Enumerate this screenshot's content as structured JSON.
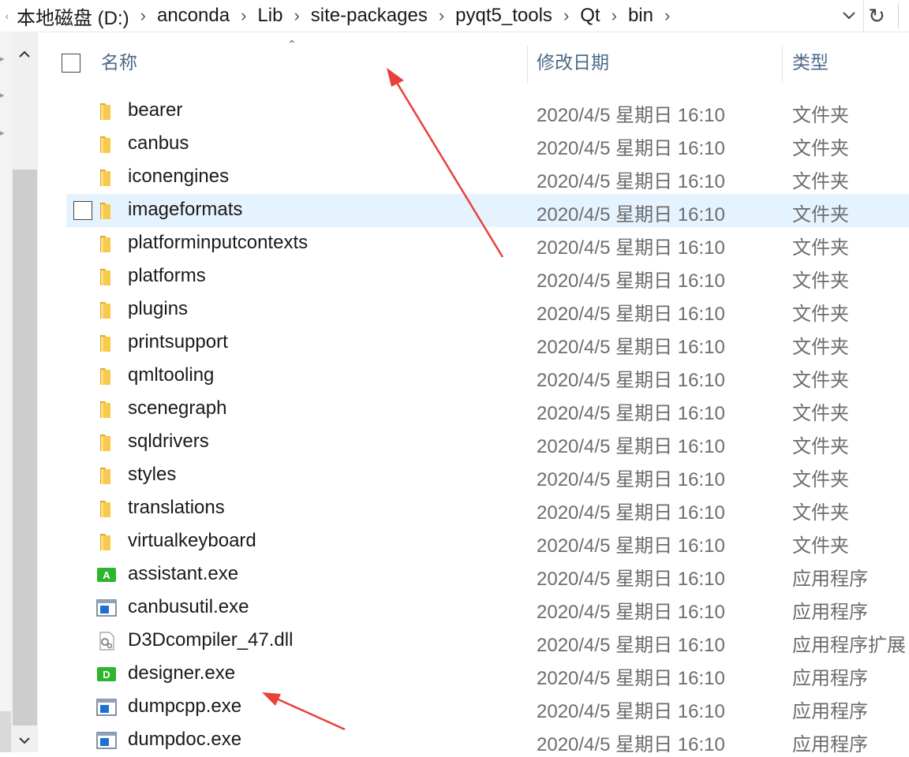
{
  "address_bar": {
    "crumbs": [
      "本地磁盘 (D:)",
      "anconda",
      "Lib",
      "site-packages",
      "pyqt5_tools",
      "Qt",
      "bin"
    ]
  },
  "header": {
    "name": "名称",
    "date": "修改日期",
    "type": "类型"
  },
  "rows": [
    {
      "name": "bearer",
      "date": "2020/4/5 星期日 16:10",
      "type": "文件夹",
      "icon": "folder"
    },
    {
      "name": "canbus",
      "date": "2020/4/5 星期日 16:10",
      "type": "文件夹",
      "icon": "folder"
    },
    {
      "name": "iconengines",
      "date": "2020/4/5 星期日 16:10",
      "type": "文件夹",
      "icon": "folder"
    },
    {
      "name": "imageformats",
      "date": "2020/4/5 星期日 16:10",
      "type": "文件夹",
      "icon": "folder"
    },
    {
      "name": "platforminputcontexts",
      "date": "2020/4/5 星期日 16:10",
      "type": "文件夹",
      "icon": "folder"
    },
    {
      "name": "platforms",
      "date": "2020/4/5 星期日 16:10",
      "type": "文件夹",
      "icon": "folder"
    },
    {
      "name": "plugins",
      "date": "2020/4/5 星期日 16:10",
      "type": "文件夹",
      "icon": "folder"
    },
    {
      "name": "printsupport",
      "date": "2020/4/5 星期日 16:10",
      "type": "文件夹",
      "icon": "folder"
    },
    {
      "name": "qmltooling",
      "date": "2020/4/5 星期日 16:10",
      "type": "文件夹",
      "icon": "folder"
    },
    {
      "name": "scenegraph",
      "date": "2020/4/5 星期日 16:10",
      "type": "文件夹",
      "icon": "folder"
    },
    {
      "name": "sqldrivers",
      "date": "2020/4/5 星期日 16:10",
      "type": "文件夹",
      "icon": "folder"
    },
    {
      "name": "styles",
      "date": "2020/4/5 星期日 16:10",
      "type": "文件夹",
      "icon": "folder"
    },
    {
      "name": "translations",
      "date": "2020/4/5 星期日 16:10",
      "type": "文件夹",
      "icon": "folder"
    },
    {
      "name": "virtualkeyboard",
      "date": "2020/4/5 星期日 16:10",
      "type": "文件夹",
      "icon": "folder"
    },
    {
      "name": "assistant.exe",
      "date": "2020/4/5 星期日 16:10",
      "type": "应用程序",
      "icon": "app-green",
      "letter": "A"
    },
    {
      "name": "canbusutil.exe",
      "date": "2020/4/5 星期日 16:10",
      "type": "应用程序",
      "icon": "app-window"
    },
    {
      "name": "D3Dcompiler_47.dll",
      "date": "2020/4/5 星期日 16:10",
      "type": "应用程序扩展",
      "icon": "dll-gear"
    },
    {
      "name": "designer.exe",
      "date": "2020/4/5 星期日 16:10",
      "type": "应用程序",
      "icon": "app-green",
      "letter": "D"
    },
    {
      "name": "dumpcpp.exe",
      "date": "2020/4/5 星期日 16:10",
      "type": "应用程序",
      "icon": "app-window"
    },
    {
      "name": "dumpdoc.exe",
      "date": "2020/4/5 星期日 16:10",
      "type": "应用程序",
      "icon": "app-window"
    }
  ],
  "hover_row_index": 3,
  "colors": {
    "header_text": "#4d6a8a",
    "hover_bg": "#e5f3ff",
    "folder": "#f8c94a",
    "app_green": "#2db52d",
    "annotation_arrow": "#e8403a"
  }
}
